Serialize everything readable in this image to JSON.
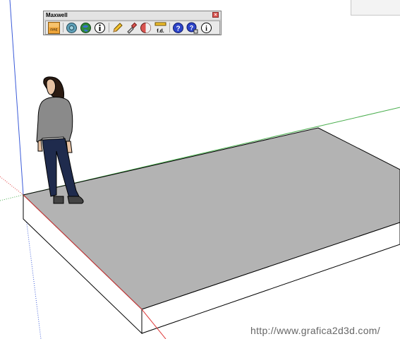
{
  "toolbar": {
    "title": "Maxwell",
    "close_glyph": "×",
    "buttons": [
      {
        "name": "fire-icon",
        "label": "FIRE"
      },
      {
        "name": "material-editor-icon",
        "label": ""
      },
      {
        "name": "environment-icon",
        "label": ""
      },
      {
        "name": "object-info-icon",
        "label": ""
      },
      {
        "name": "pencil-icon",
        "label": ""
      },
      {
        "name": "eyedropper-icon",
        "label": ""
      },
      {
        "name": "material-sphere-icon",
        "label": ""
      },
      {
        "name": "focus-distance-icon",
        "label": "f.d."
      },
      {
        "name": "help-icon",
        "label": "?"
      },
      {
        "name": "help-search-icon",
        "label": "?"
      },
      {
        "name": "about-icon",
        "label": "i"
      }
    ]
  },
  "watermark": "http://www.grafica2d3d.com/",
  "colors": {
    "slab_top": "#b3b3b3",
    "slab_side": "#ffffff",
    "axis_red": "#e04040",
    "axis_green": "#4caf50",
    "axis_blue": "#3b5bd9"
  }
}
